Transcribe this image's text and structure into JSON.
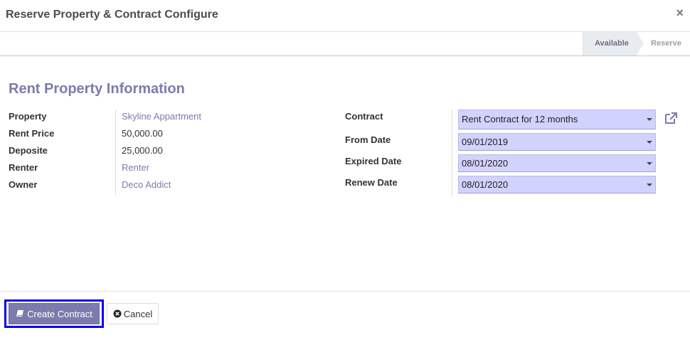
{
  "dialog": {
    "title": "Reserve Property & Contract Configure",
    "close_label": "×"
  },
  "statusbar": {
    "stages": [
      "Available",
      "Reserve"
    ],
    "active_stage": "Available"
  },
  "form": {
    "section_title": "Rent Property Information",
    "left_fields": [
      {
        "label": "Property",
        "value": "Skyline Appartment",
        "is_link": true
      },
      {
        "label": "Rent Price",
        "value": "50,000.00",
        "is_link": false
      },
      {
        "label": "Deposite",
        "value": "25,000.00",
        "is_link": false
      },
      {
        "label": "Renter",
        "value": "Renter",
        "is_link": true
      },
      {
        "label": "Owner",
        "value": "Deco Addict",
        "is_link": true
      }
    ],
    "right_fields": [
      {
        "label": "Contract",
        "value": "Rent Contract for 12 months"
      },
      {
        "label": "From Date",
        "value": "09/01/2019"
      },
      {
        "label": "Expired Date",
        "value": "08/01/2020"
      },
      {
        "label": "Renew Date",
        "value": "08/01/2020"
      }
    ]
  },
  "footer": {
    "primary_label": "Create Contract",
    "secondary_label": "Cancel"
  },
  "icons": {
    "primary_button_icon": "book-icon",
    "secondary_button_icon": "times-circle-icon",
    "contract_link_icon": "external-link-icon"
  },
  "colors": {
    "accent": "#7c7bad",
    "required_field_bg": "#d2d2ff",
    "highlight_border": "#0000ee"
  }
}
